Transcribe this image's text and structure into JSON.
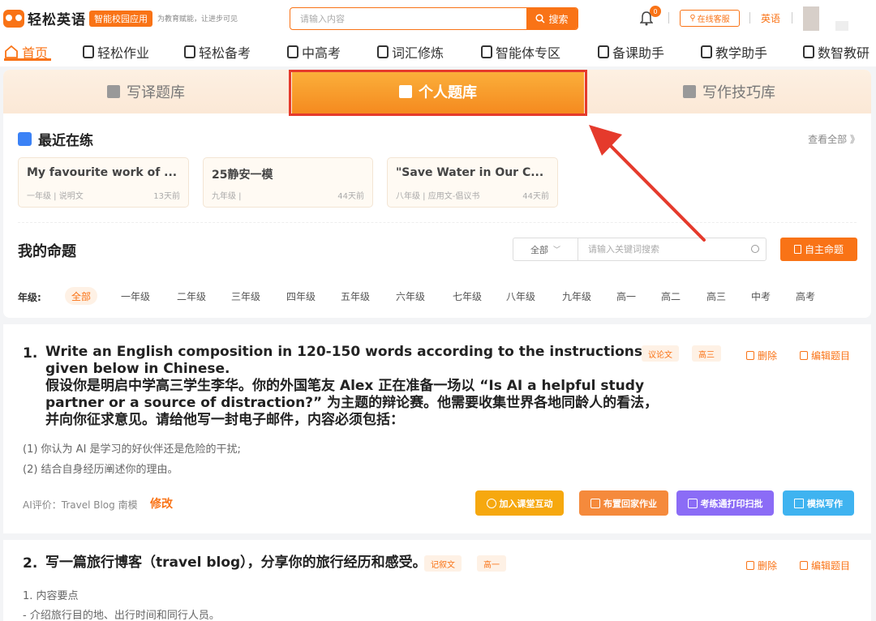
{
  "header": {
    "logo_text": "轻松英语",
    "logo_badge": "智能校园应用",
    "slogan": "为教育赋能，让进步可见",
    "search_placeholder": "请输入内容",
    "search_button": "搜索",
    "notification_count": "0",
    "service_label": "在线客服",
    "language": "英语"
  },
  "nav": {
    "items": [
      {
        "label": "首页",
        "icon": "home-icon"
      },
      {
        "label": "轻松作业",
        "icon": "shield-icon"
      },
      {
        "label": "轻松备考",
        "icon": "doc-icon"
      },
      {
        "label": "中高考",
        "icon": "paper-icon"
      },
      {
        "label": "词汇修炼",
        "icon": "book-icon"
      },
      {
        "label": "智能体专区",
        "icon": "check-icon"
      },
      {
        "label": "备课助手",
        "icon": "clipboard-icon"
      },
      {
        "label": "教学助手",
        "icon": "bookmark-icon"
      },
      {
        "label": "数智教研",
        "icon": "shield-icon"
      }
    ]
  },
  "tabs": [
    {
      "label": "写译题库",
      "icon": "list-icon"
    },
    {
      "label": "个人题库",
      "icon": "picture-icon"
    },
    {
      "label": "写作技巧库",
      "icon": "pen-icon"
    }
  ],
  "recent": {
    "title": "最近在练",
    "view_all": "查看全部 》",
    "cards": [
      {
        "title": "My favourite work of ...",
        "meta": "一年级 | 说明文",
        "time": "13天前"
      },
      {
        "title": "25静安一模",
        "meta": "九年级 |",
        "time": "44天前"
      },
      {
        "title": "\"Save Water in Our C...",
        "meta": "八年级 | 应用文-倡议书",
        "time": "44天前"
      }
    ]
  },
  "my_questions": {
    "title": "我的命题",
    "filter_select": "全部",
    "filter_placeholder": "请输入关键词搜索",
    "create_button": "自主命题",
    "grade_label": "年级:",
    "grades": [
      "全部",
      "一年级",
      "二年级",
      "三年级",
      "四年级",
      "五年级",
      "六年级",
      "七年级",
      "八年级",
      "九年级",
      "高一",
      "高二",
      "高三",
      "中考",
      "高考"
    ]
  },
  "questions": [
    {
      "number": "1.",
      "lines": [
        "Write an English composition in 120-150 words according to the instructions",
        "given below in Chinese.",
        "假设你是明启中学高三学生李华。你的外国笔友 Alex 正在准备一场以 “Is AI a helpful study",
        "partner or a source of distraction?” 为主题的辩论赛。他需要收集世界各地同龄人的看法，",
        "并向你征求意见。请给他写一封电子邮件，内容必须包括："
      ],
      "requirements": [
        "(1) 你认为 AI 是学习的好伙伴还是危险的干扰;",
        "(2) 结合自身经历阐述你的理由。"
      ],
      "tags": [
        "议论文",
        "高三"
      ],
      "delete": "删除",
      "edit": "编辑题目",
      "ai_eval": "AI评价：Travel Blog 南模",
      "ai_modify": "修改",
      "buttons": [
        "加入课堂互动",
        "布置回家作业",
        "考练通打印扫批",
        "模拟写作"
      ]
    },
    {
      "number": "2.",
      "lines": [
        "写一篇旅行博客（travel blog），分享你的旅行经历和感受。"
      ],
      "requirements": [
        "1. 内容要点",
        "- 介绍旅行目的地、出行时间和同行人员。"
      ],
      "tags": [
        "记叙文",
        "高一"
      ],
      "delete": "删除",
      "edit": "编辑题目"
    }
  ],
  "colors": {
    "accent": "#f97316",
    "highlight": "#e53a2c",
    "btn_yellow": "#f6a80f",
    "btn_orange": "#f58a3c",
    "btn_purple": "#8b6cf6",
    "btn_blue": "#3fb3f0"
  }
}
